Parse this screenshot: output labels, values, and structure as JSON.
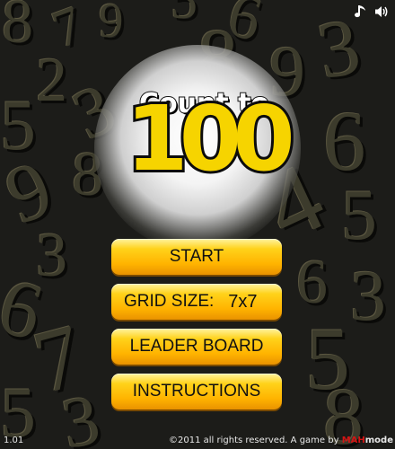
{
  "title": {
    "line1": "Count to",
    "line2": "100"
  },
  "menu": {
    "start": "START",
    "grid_size_label": "GRID SIZE:",
    "grid_size_value": "7x7",
    "leader_board": "LEADER BOARD",
    "instructions": "INSTRUCTIONS"
  },
  "icons": [
    "music-note-icon",
    "speaker-icon"
  ],
  "version": "1.01",
  "footer": {
    "text": "©2011 all rights reserved. A game by",
    "brand_part1": "MAH",
    "brand_part2": "mode"
  },
  "colors": {
    "background": "#1c1c19",
    "button": "#ffc20e",
    "title_number": "#f6d400",
    "brand_red": "#d41414"
  }
}
